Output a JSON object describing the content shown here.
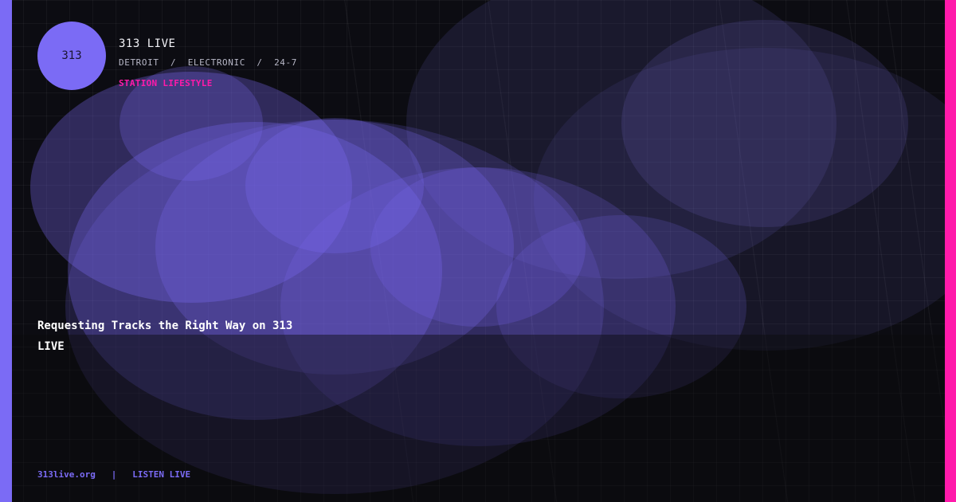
{
  "brand": {
    "logo_text": "313",
    "name": "313 LIVE",
    "location": "DETROIT",
    "genre": "ELECTRONIC",
    "schedule": "24-7",
    "separator": "/",
    "category": "STATION LIFESTYLE"
  },
  "article": {
    "headline": "Requesting Tracks the Right Way on 313 LIVE"
  },
  "footer": {
    "domain": "313live.org",
    "divider": "|",
    "cta": "LISTEN LIVE"
  },
  "colors": {
    "background": "#0c0c12",
    "accent": "#7b6bf5",
    "accent_secondary": "#ff1aaa",
    "text": "#ffffff",
    "muted": "#b7b7c6"
  }
}
